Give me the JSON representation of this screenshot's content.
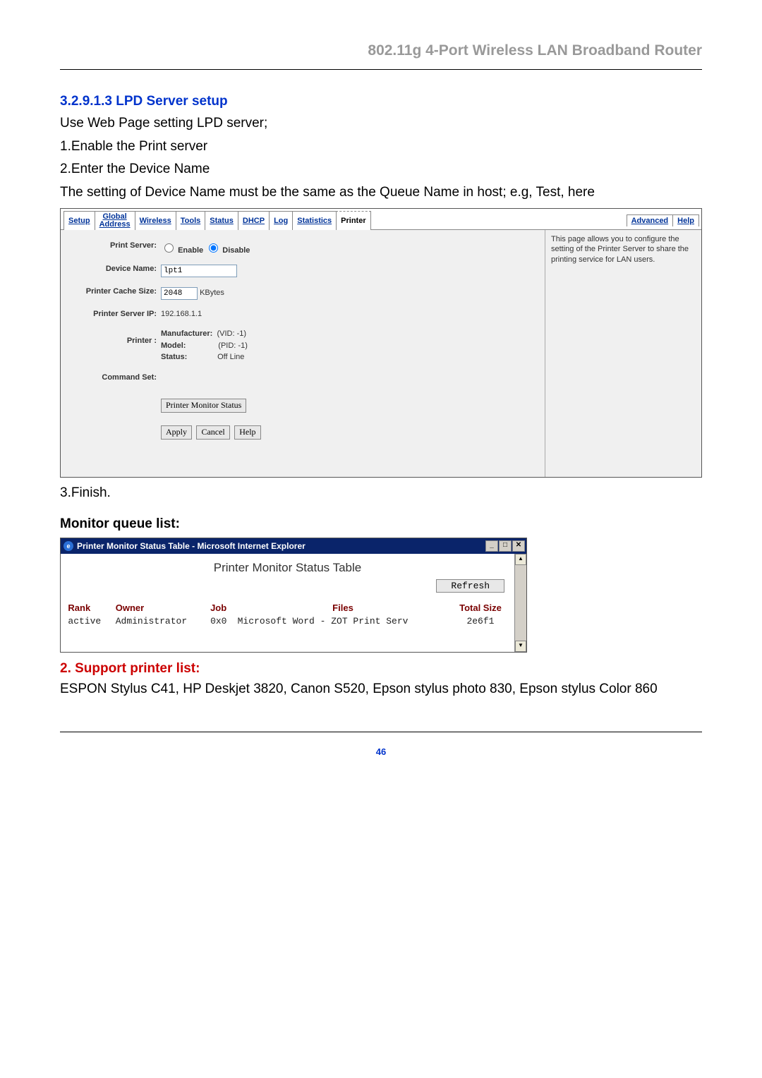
{
  "header": {
    "title": "802.11g 4-Port Wireless LAN Broadband Router"
  },
  "section_lpd": {
    "number_title": "3.2.9.1.3 LPD Server setup",
    "line1": "Use Web Page setting LPD server;",
    "line2": "1.Enable the Print server",
    "line3": "2.Enter the Device Name",
    "line4": "The setting of Device Name must be the same as the Queue Name in host; e.g, Test, here"
  },
  "router_ui": {
    "tabs_left": [
      "Setup",
      "Global Address",
      "Wireless",
      "Tools",
      "Status",
      "DHCP",
      "Log",
      "Statistics",
      "Printer"
    ],
    "tabs_right": [
      "Advanced",
      "Help"
    ],
    "active_tab": "Printer",
    "help_text": "This page allows you to configure the setting of the Printer Server to share the printing service for LAN users.",
    "form": {
      "print_server_label": "Print Server:",
      "enable_label": "Enable",
      "disable_label": "Disable",
      "disable_checked": true,
      "device_name_label": "Device Name:",
      "device_name_value": "lpt1",
      "cache_label": "Printer Cache Size:",
      "cache_value": "2048",
      "cache_units": "KBytes",
      "server_ip_label": "Printer Server IP:",
      "server_ip_value": "192.168.1.1",
      "printer_label": "Printer :",
      "manufacturer_label": "Manufacturer:",
      "manufacturer_value": "(VID: -1)",
      "model_label": "Model:",
      "model_value": "(PID: -1)",
      "status_label": "Status:",
      "status_value": "Off Line",
      "command_set_label": "Command Set:",
      "command_set_value": "",
      "monitor_btn": "Printer Monitor Status",
      "apply_btn": "Apply",
      "cancel_btn": "Cancel",
      "help_btn": "Help"
    }
  },
  "after_panel": {
    "finish": "3.Finish.",
    "monitor_heading": "Monitor queue list:"
  },
  "ie_window": {
    "title": "Printer Monitor Status Table - Microsoft Internet Explorer",
    "page_title": "Printer Monitor Status Table",
    "refresh_btn": "Refresh",
    "columns": [
      "Rank",
      "Owner",
      "Job",
      "Files",
      "Total Size"
    ],
    "row": {
      "rank": "active",
      "owner": "Administrator",
      "job": "0x0",
      "files": "Microsoft Word - ZOT Print Serv",
      "total_size": "2e6f1"
    }
  },
  "support": {
    "heading": "2. Support printer list:",
    "body": "ESPON Stylus C41, HP Deskjet 3820, Canon S520, Epson stylus photo 830, Epson stylus Color 860"
  },
  "page_number": "46"
}
